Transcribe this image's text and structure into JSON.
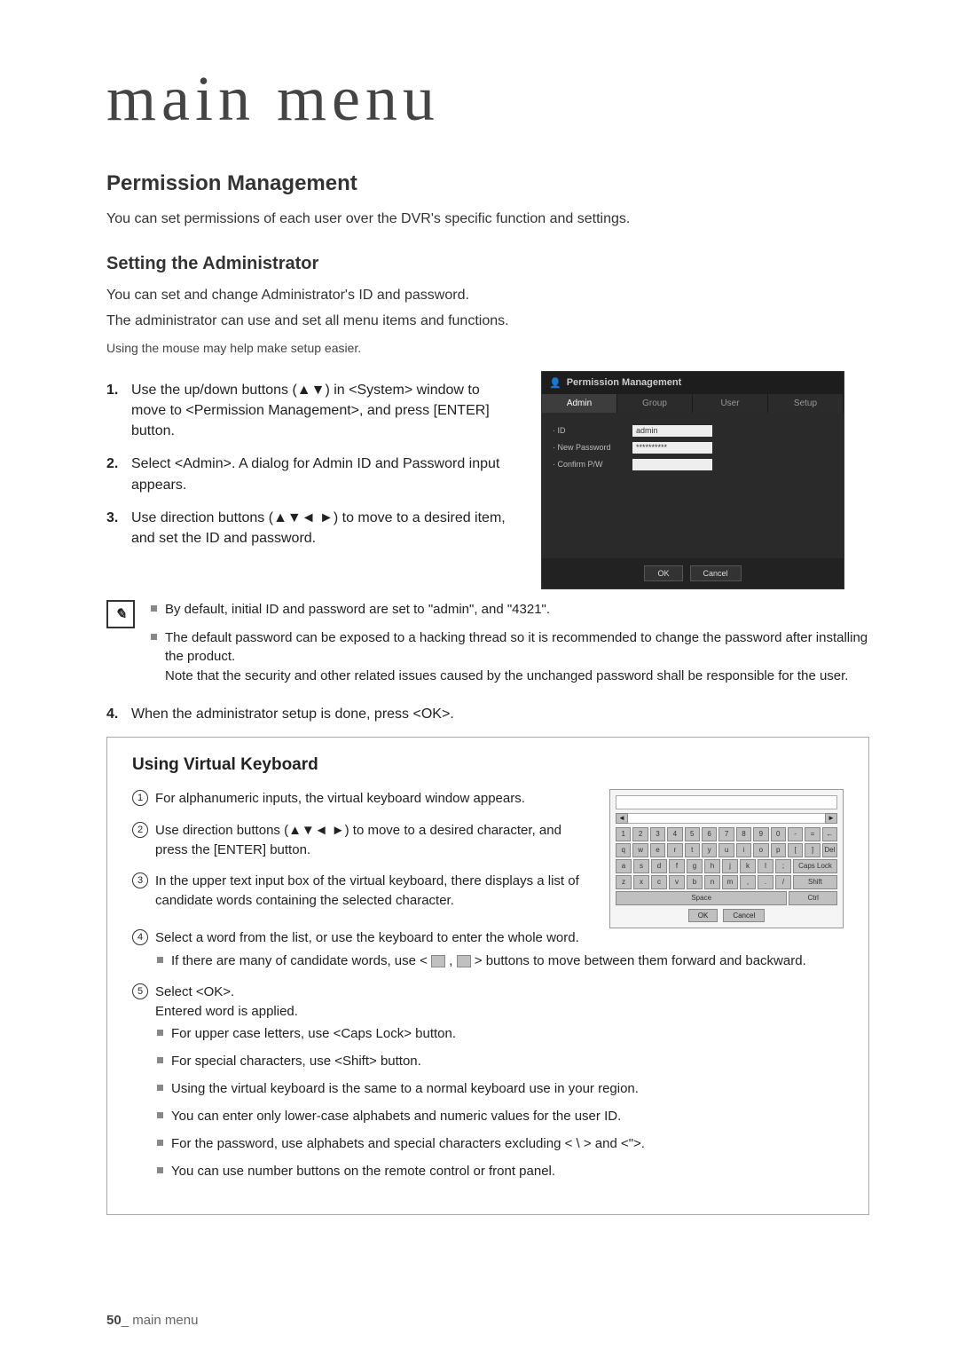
{
  "page": {
    "big_title": "main menu",
    "footer_page": "50",
    "footer_sep": "_",
    "footer_text": "main menu"
  },
  "section": {
    "title": "Permission Management",
    "intro": "You can set permissions of each user over the DVR's specific function and settings."
  },
  "admin": {
    "title": "Setting the Administrator",
    "p1": "You can set and change Administrator's ID and password.",
    "p2": "The administrator can use and set all menu items and functions.",
    "mouse_note": "Using the mouse may help make setup easier.",
    "steps": {
      "s1": "Use the up/down buttons (▲▼) in <System> window to move to <Permission Management>, and press [ENTER] button.",
      "s2": "Select <Admin>. A dialog for Admin ID and Password input appears.",
      "s3": "Use direction buttons (▲▼◄ ►) to move to a desired item, and set the ID and password.",
      "s4": "When the administrator setup is done, press <OK>."
    },
    "notes": {
      "n1": "By default, initial ID and password are set to \"admin\", and \"4321\".",
      "n2a": "The default password can be exposed to a hacking thread so it is recommended to change the password after installing the product.",
      "n2b": "Note that the security and other related issues caused by the unchanged password shall be responsible for the user."
    }
  },
  "dvr": {
    "window_title": "Permission Management",
    "tabs": [
      "Admin",
      "Group",
      "User",
      "Setup"
    ],
    "fields": {
      "id_label": "· ID",
      "id_value": "admin",
      "newpw_label": "· New Password",
      "newpw_value": "**********",
      "confirm_label": "· Confirm P/W",
      "confirm_value": ""
    },
    "ok": "OK",
    "cancel": "Cancel"
  },
  "vk": {
    "title": "Using Virtual Keyboard",
    "step1": "For alphanumeric inputs, the virtual keyboard window appears.",
    "step2": "Use direction buttons (▲▼◄ ►) to move to a desired character, and press the [ENTER] button.",
    "step3": "In the upper text input box of the virtual keyboard, there displays a list of candidate words containing the selected character.",
    "step4": "Select a word from the list, or use the keyboard to enter the whole word.",
    "step4_sub": "If there are many of candidate words, use <  ,  > buttons to move between them forward and backward.",
    "step5_a": "Select <OK>.",
    "step5_b": "Entered word is applied.",
    "tips": {
      "t1": "For upper case letters, use <Caps Lock> button.",
      "t2": "For special characters, use <Shift> button.",
      "t3": "Using the virtual keyboard is the same to a normal keyboard use in your region.",
      "t4": "You can enter only lower-case alphabets and numeric values for the user ID.",
      "t5": "For the password, use alphabets and special characters excluding < \\ > and <\">.",
      "t6": "You can use number buttons on the remote control or front panel."
    },
    "keys": {
      "row1": [
        "1",
        "2",
        "3",
        "4",
        "5",
        "6",
        "7",
        "8",
        "9",
        "0",
        "-",
        "=",
        "←"
      ],
      "row2": [
        "q",
        "w",
        "e",
        "r",
        "t",
        "y",
        "u",
        "i",
        "o",
        "p",
        "[",
        "]",
        "Del"
      ],
      "row3": [
        "a",
        "s",
        "d",
        "f",
        "g",
        "h",
        "j",
        "k",
        "l",
        ";",
        "Caps Lock"
      ],
      "row4": [
        "z",
        "x",
        "c",
        "v",
        "b",
        "n",
        "m",
        ",",
        ".",
        "/",
        "Shift"
      ],
      "row5_space": "Space",
      "row5_ctrl": "Ctrl"
    },
    "ok": "OK",
    "cancel": "Cancel",
    "arrow_left": "◄",
    "arrow_right": "►"
  }
}
